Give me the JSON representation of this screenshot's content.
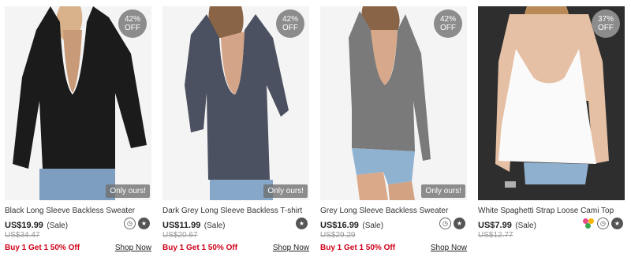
{
  "products": [
    {
      "badge_pct": "42%",
      "badge_off": "OFF",
      "only_label": "Only ours!",
      "title": "Black Long Sleeve Backless Sweater",
      "price": "US$19.99",
      "sale": "(Sale)",
      "original": "US$34.47",
      "promo": "Buy 1 Get 1 50% Off",
      "shop": "Shop Now",
      "icons": [
        "clock-icon",
        "star-icon"
      ],
      "colors": {
        "garment": "#1b1b1b",
        "bg": "#f4f4f4"
      }
    },
    {
      "badge_pct": "42%",
      "badge_off": "OFF",
      "only_label": "Only ours!",
      "title": "Dark Grey Long Sleeve Backless T-shirt",
      "price": "US$11.99",
      "sale": "(Sale)",
      "original": "US$20.67",
      "promo": "Buy 1 Get 1 50% Off",
      "shop": "Shop Now",
      "icons": [
        "star-icon"
      ],
      "colors": {
        "garment": "#4b5160",
        "bg": "#f4f4f4"
      }
    },
    {
      "badge_pct": "42%",
      "badge_off": "OFF",
      "only_label": "Only ours!",
      "title": "Grey Long Sleeve Backless Sweater",
      "price": "US$16.99",
      "sale": "(Sale)",
      "original": "US$29.29",
      "promo": "Buy 1 Get 1 50% Off",
      "shop": "Shop Now",
      "icons": [
        "clock-icon",
        "star-icon"
      ],
      "colors": {
        "garment": "#7a7a7a",
        "bg": "#f4f4f4"
      }
    },
    {
      "badge_pct": "37%",
      "badge_off": "OFF",
      "title": "White Spaghetti Strap Loose Cami Top",
      "price": "US$7.99",
      "sale": "(Sale)",
      "original": "US$12.77",
      "icons": [
        "color-dots-icon",
        "clock-icon",
        "star-icon"
      ],
      "colors": {
        "garment": "#fafafa",
        "bg": "#2e2e2e"
      }
    }
  ],
  "colors": {
    "promo": "#d0021b",
    "badge": "#8c8c8c"
  }
}
